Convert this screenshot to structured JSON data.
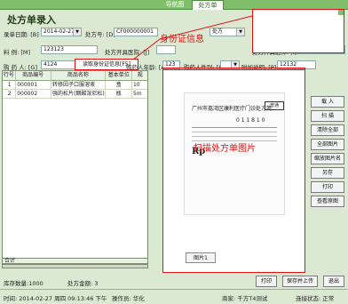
{
  "tabs": [
    "导航图",
    "处方单"
  ],
  "page_title": "处方单录入",
  "form": {
    "date_label": "录单日期: [B]",
    "date_value": "2014-02-27",
    "rx_no_label": "处方号: [D]",
    "rx_no_value": "CF000000001",
    "source_value": "处方",
    "material_label": "料    例: [M]",
    "material_value": "123123",
    "rx_hospital_label": "处方开具医院: [J]",
    "rx_doctor_label": "处方开具医师: [I]",
    "rx_doctor_value": "12312",
    "buyer_label": "购 药 人: [G]",
    "buyer_value": "4124",
    "read_id_button": "读取身份证信息[F5]",
    "buyer_age_label": "购药人年龄: [A]",
    "buyer_age_value": "123",
    "buyer_sex_label": "购药人性别: [S]",
    "extra_label": "附加说明: [P]",
    "extra_value": "12132"
  },
  "annotations": {
    "id_info": "身份证信息",
    "scan_rx": "扫描处方单图片"
  },
  "table": {
    "headers": [
      "行号",
      "商品编号",
      "商品名称",
      "基本单位",
      "规"
    ],
    "rows": [
      [
        "1",
        "000001",
        "转移因子口服溶液",
        "盒",
        "10"
      ],
      [
        "2",
        "000002",
        "强的松片(醋酸泼尼松)",
        "瓶",
        "5m"
      ]
    ],
    "footer": "合计"
  },
  "rx_paper": {
    "hospital": "广州市荔湾区康利医疗门诊处方笺",
    "stamp": "普通",
    "number": "0 1 1 8 1 0",
    "rp": "Rp"
  },
  "image_tab": "图片1",
  "right_buttons": [
    "载 入",
    "扫 描",
    "清除全部",
    "全部图片",
    "缩放图片名",
    "另存",
    "打印",
    "查看原图"
  ],
  "summary": {
    "stock_label": "库存数量:1000",
    "amount_label": "处方金额: 3"
  },
  "actions": [
    "打印",
    "保存并上传",
    "退出"
  ],
  "status": {
    "time": "时间: 2014-02-27 周四 09:13:46 下午",
    "operator": "操作员: 华化",
    "store": "商家: 千方T4测试",
    "state": "连接状态: 正常"
  },
  "colors": {
    "accent_red": "#e01010",
    "header_green": "#7fbf6a"
  }
}
